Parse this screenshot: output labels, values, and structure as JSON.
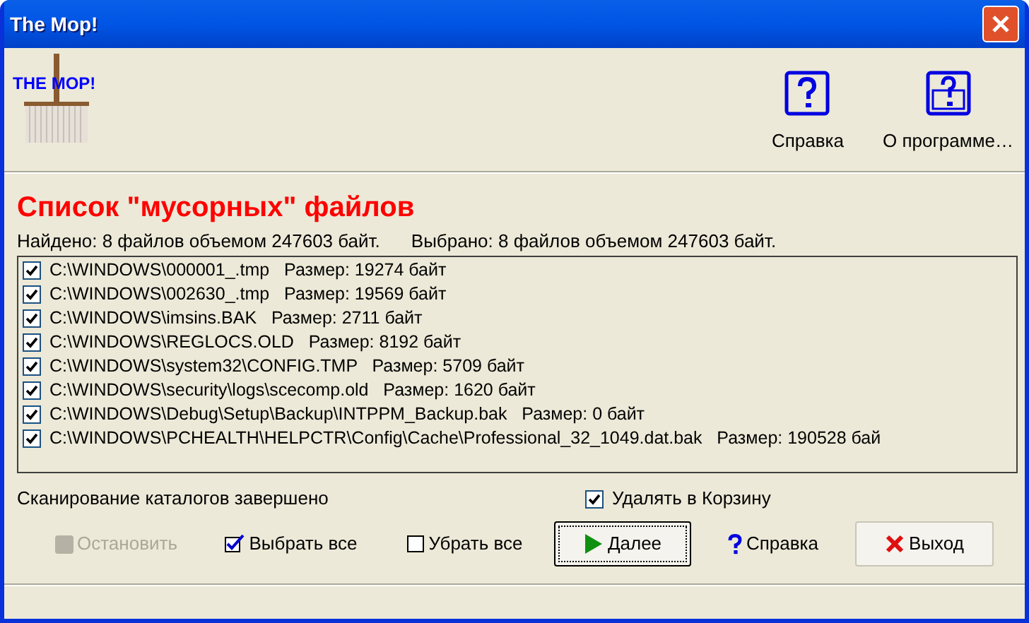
{
  "window": {
    "title": "The Mop!"
  },
  "logo": {
    "text": "THE MOP!"
  },
  "toolbar": [
    {
      "label": "Справка",
      "kind": "help"
    },
    {
      "label": "О программе…",
      "kind": "about"
    }
  ],
  "heading": "Список \"мусорных\" файлов",
  "found": "Найдено: 8 файлов объемом 247603 байт.",
  "selected_info": "Выбрано: 8 файлов объемом 247603 байт.",
  "files": [
    {
      "path": "C:\\WINDOWS\\000001_.tmp",
      "size": "Размер: 19274 байт",
      "checked": true
    },
    {
      "path": "C:\\WINDOWS\\002630_.tmp",
      "size": "Размер: 19569 байт",
      "checked": true
    },
    {
      "path": "C:\\WINDOWS\\imsins.BAK",
      "size": "Размер: 2711 байт",
      "checked": true
    },
    {
      "path": "C:\\WINDOWS\\REGLOCS.OLD",
      "size": "Размер: 8192 байт",
      "checked": true
    },
    {
      "path": "C:\\WINDOWS\\system32\\CONFIG.TMP",
      "size": "Размер: 5709 байт",
      "checked": true
    },
    {
      "path": "C:\\WINDOWS\\security\\logs\\scecomp.old",
      "size": "Размер: 1620 байт",
      "checked": true
    },
    {
      "path": "C:\\WINDOWS\\Debug\\Setup\\Backup\\INTPPM_Backup.bak",
      "size": "Размер: 0 байт",
      "checked": true
    },
    {
      "path": "C:\\WINDOWS\\PCHEALTH\\HELPCTR\\Config\\Cache\\Professional_32_1049.dat.bak",
      "size": "Размер: 190528 бай",
      "checked": true
    }
  ],
  "status": "Сканирование каталогов завершено",
  "recycle": {
    "label": "Удалять в Корзину",
    "checked": true
  },
  "actions": [
    {
      "label": "Остановить",
      "kind": "stop",
      "disabled": true
    },
    {
      "label": "Выбрать все",
      "kind": "select_all",
      "disabled": false
    },
    {
      "label": "Убрать все",
      "kind": "clear_all",
      "disabled": false
    },
    {
      "label": "Далее",
      "kind": "next",
      "disabled": false
    },
    {
      "label": "Справка",
      "kind": "help",
      "disabled": false
    },
    {
      "label": "Выход",
      "kind": "exit",
      "disabled": false
    }
  ]
}
